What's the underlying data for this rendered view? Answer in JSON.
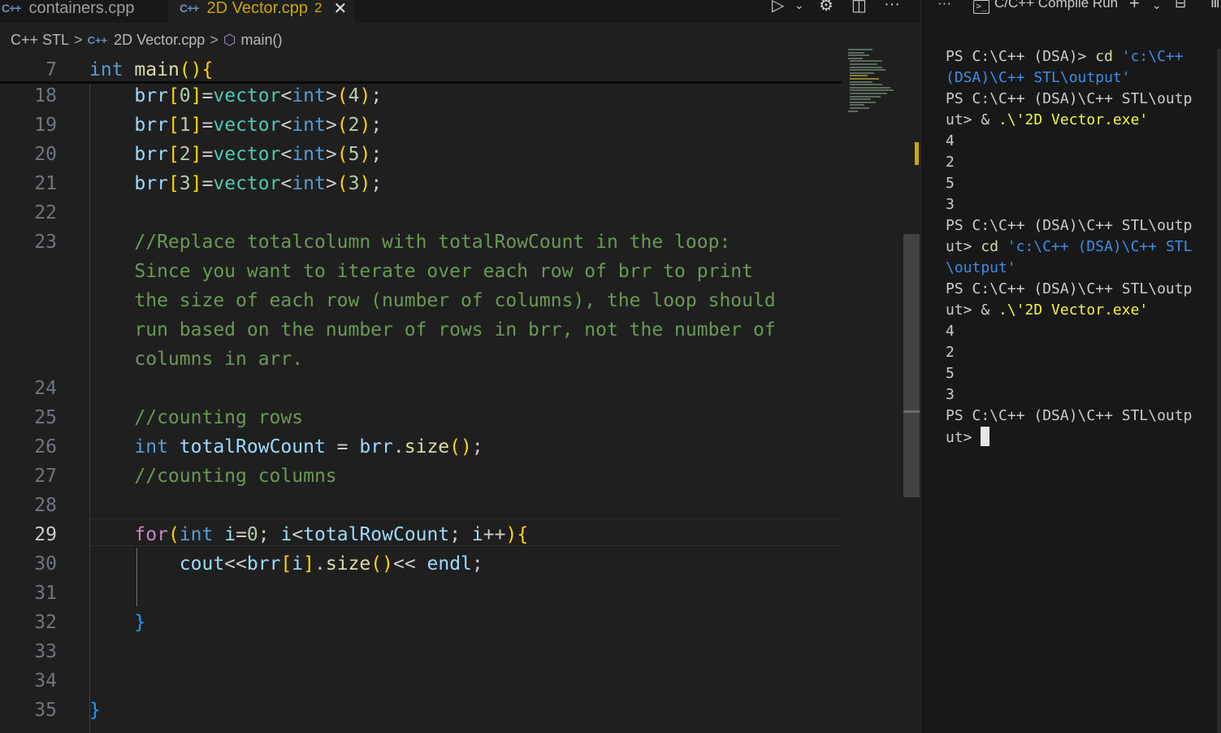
{
  "tabs": [
    {
      "label": "containers.cpp",
      "active": false,
      "icon": "cpp-file-icon"
    },
    {
      "label": "2D Vector.cpp",
      "active": true,
      "problems": "2",
      "icon": "cpp-file-icon"
    }
  ],
  "file_icon_text": "C++",
  "breadcrumb": [
    "C++ STL",
    "2D Vector.cpp",
    "main()"
  ],
  "editor": {
    "sticky_line": {
      "num": "7",
      "text": "int main(){"
    },
    "lines": [
      {
        "num": "18",
        "text": "    brr[0]=vector<int>(4);"
      },
      {
        "num": "19",
        "text": "    brr[1]=vector<int>(2);"
      },
      {
        "num": "20",
        "text": "    brr[2]=vector<int>(5);"
      },
      {
        "num": "21",
        "text": "    brr[3]=vector<int>(3);"
      },
      {
        "num": "22",
        "text": ""
      },
      {
        "num": "23",
        "text": "    //Replace totalcolumn with totalRowCount in the loop:"
      },
      {
        "num": "",
        "text": "    Since you want to iterate over each row of brr to print"
      },
      {
        "num": "",
        "text": "    the size of each row (number of columns), the loop should"
      },
      {
        "num": "",
        "text": "    run based on the number of rows in brr, not the number of"
      },
      {
        "num": "",
        "text": "    columns in arr."
      },
      {
        "num": "24",
        "text": ""
      },
      {
        "num": "25",
        "text": "    //counting rows"
      },
      {
        "num": "26",
        "text": "    int totalRowCount = brr.size();"
      },
      {
        "num": "27",
        "text": "    //counting columns"
      },
      {
        "num": "28",
        "text": ""
      },
      {
        "num": "29",
        "text": "    for(int i=0; i<totalRowCount; i++){"
      },
      {
        "num": "30",
        "text": "        cout<<brr[i].size()<< endl;"
      },
      {
        "num": "31",
        "text": ""
      },
      {
        "num": "32",
        "text": "    }"
      },
      {
        "num": "33",
        "text": ""
      },
      {
        "num": "34",
        "text": ""
      },
      {
        "num": "35",
        "text": "}"
      }
    ],
    "active_line": "29"
  },
  "toolbar_icons": [
    "run-icon",
    "chevron-down-icon",
    "settings-gear-icon",
    "split-editor-icon",
    "more-actions-icon"
  ],
  "panel": {
    "more_label": "···",
    "terminal_title": "C/C++ Compile Run",
    "icons": [
      "terminal-icon",
      "add-terminal-icon",
      "chevron-down-icon",
      "maximize-panel-icon",
      "terminal-list-icon"
    ],
    "terminal_lines": [
      {
        "parts": [
          {
            "t": "PS C:\\C++ (DSA)> ",
            "c": ""
          },
          {
            "t": "cd ",
            "c": "t-cmd"
          },
          {
            "t": "'c:\\C++",
            "c": "t-str"
          }
        ]
      },
      {
        "parts": [
          {
            "t": "(DSA)\\C++ STL\\output'",
            "c": "t-str"
          }
        ]
      },
      {
        "parts": [
          {
            "t": "PS C:\\C++ (DSA)\\C++ STL\\outp",
            "c": ""
          }
        ]
      },
      {
        "parts": [
          {
            "t": "ut> & ",
            "c": ""
          },
          {
            "t": ".\\'2D Vector.exe'",
            "c": "t-s2"
          }
        ]
      },
      {
        "parts": [
          {
            "t": "4",
            "c": ""
          }
        ]
      },
      {
        "parts": [
          {
            "t": "2",
            "c": ""
          }
        ]
      },
      {
        "parts": [
          {
            "t": "5",
            "c": ""
          }
        ]
      },
      {
        "parts": [
          {
            "t": "3",
            "c": ""
          }
        ]
      },
      {
        "parts": [
          {
            "t": "PS C:\\C++ (DSA)\\C++ STL\\outp",
            "c": ""
          }
        ]
      },
      {
        "parts": [
          {
            "t": "ut> ",
            "c": ""
          },
          {
            "t": "cd ",
            "c": "t-cmd"
          },
          {
            "t": "'c:\\C++ (DSA)\\C++ STL",
            "c": "t-str"
          }
        ]
      },
      {
        "parts": [
          {
            "t": "\\output'",
            "c": "t-str"
          }
        ]
      },
      {
        "parts": [
          {
            "t": "PS C:\\C++ (DSA)\\C++ STL\\outp",
            "c": ""
          }
        ]
      },
      {
        "parts": [
          {
            "t": "ut> & ",
            "c": ""
          },
          {
            "t": ".\\'2D Vector.exe'",
            "c": "t-s2"
          }
        ]
      },
      {
        "parts": [
          {
            "t": "4",
            "c": ""
          }
        ]
      },
      {
        "parts": [
          {
            "t": "2",
            "c": ""
          }
        ]
      },
      {
        "parts": [
          {
            "t": "5",
            "c": ""
          }
        ]
      },
      {
        "parts": [
          {
            "t": "3",
            "c": ""
          }
        ]
      },
      {
        "parts": [
          {
            "t": "PS C:\\C++ (DSA)\\C++ STL\\outp",
            "c": ""
          }
        ]
      },
      {
        "parts": [
          {
            "t": "ut> ",
            "c": ""
          }
        ],
        "cursor": true
      }
    ]
  },
  "colors": {
    "keyword": "#569cd6",
    "control": "#c586c0",
    "function": "#dcdcaa",
    "variable": "#9cdcfe",
    "type": "#4ec9b0",
    "number": "#b5cea8",
    "comment": "#6a9955",
    "warning_tab": "#cca700"
  }
}
